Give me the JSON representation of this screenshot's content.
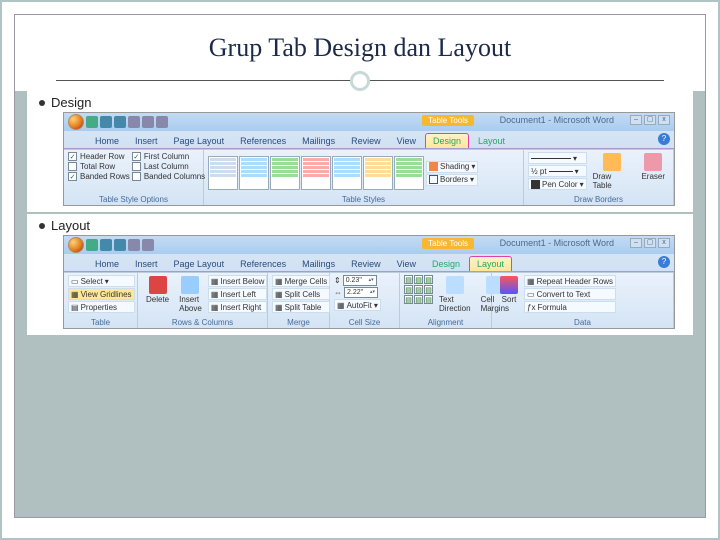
{
  "title": "Grup Tab Design dan Layout",
  "sections": {
    "design_label": "Design",
    "layout_label": "Layout"
  },
  "windowTitle": "Document1 - Microsoft Word",
  "contextTab": "Table Tools",
  "tabs": [
    "Home",
    "Insert",
    "Page Layout",
    "References",
    "Mailings",
    "Review",
    "View",
    "Design",
    "Layout"
  ],
  "design": {
    "tso": {
      "group": "Table Style Options",
      "headerRow": "Header Row",
      "totalRow": "Total Row",
      "bandedRows": "Banded Rows",
      "firstCol": "First Column",
      "lastCol": "Last Column",
      "bandedCols": "Banded Columns"
    },
    "styles": {
      "group": "Table Styles",
      "shading": "Shading",
      "borders": "Borders"
    },
    "drawb": {
      "group": "Draw Borders",
      "weight": "½ pt",
      "penColor": "Pen Color",
      "drawTable": "Draw Table",
      "eraser": "Eraser"
    }
  },
  "layout": {
    "table": {
      "group": "Table",
      "select": "Select",
      "viewGrid": "View Gridlines",
      "properties": "Properties"
    },
    "rc": {
      "group": "Rows & Columns",
      "delete": "Delete",
      "above": "Insert Above",
      "below": "Insert Below",
      "left": "Insert Left",
      "right": "Insert Right"
    },
    "merge": {
      "group": "Merge",
      "mergeCells": "Merge Cells",
      "splitCells": "Split Cells",
      "splitTable": "Split Table"
    },
    "size": {
      "group": "Cell Size",
      "h": "0.23\"",
      "w": "2.22\"",
      "autofit": "AutoFit"
    },
    "align": {
      "group": "Alignment",
      "textDir": "Text Direction",
      "margins": "Cell Margins"
    },
    "data": {
      "group": "Data",
      "sort": "Sort",
      "repeat": "Repeat Header Rows",
      "convert": "Convert to Text",
      "formula": "Formula"
    }
  }
}
